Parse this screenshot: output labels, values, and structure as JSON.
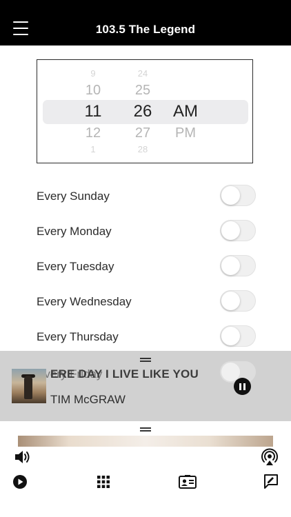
{
  "header": {
    "title": "103.5 The Legend",
    "menu_icon": "hamburger-menu-icon"
  },
  "time_picker": {
    "hours": [
      "9",
      "10",
      "11",
      "12",
      "1"
    ],
    "minutes": [
      "24",
      "25",
      "26",
      "27",
      "28"
    ],
    "meridiem": [
      "AM",
      "PM"
    ],
    "selected": {
      "hour": "11",
      "minute": "26",
      "meridiem": "AM"
    }
  },
  "repeat_days": [
    {
      "label": "Every Sunday",
      "on": false
    },
    {
      "label": "Every Monday",
      "on": false
    },
    {
      "label": "Every Tuesday",
      "on": false
    },
    {
      "label": "Every Wednesday",
      "on": false
    },
    {
      "label": "Every Thursday",
      "on": false
    },
    {
      "label": "Every Friday",
      "on": false
    }
  ],
  "now_playing": {
    "title": "ERE DAY I LIVE LIKE YOU",
    "artist": "TIM McGRAW",
    "state": "playing"
  },
  "bottom_nav": {
    "icons": [
      "volume-icon",
      "airplay-icon",
      "play-icon",
      "grid-icon",
      "contact-card-icon",
      "chat-icon"
    ]
  },
  "colors": {
    "header_bg": "#000000",
    "player_bg": "#cdcdcd",
    "toggle_off": "#f0f0f0"
  }
}
